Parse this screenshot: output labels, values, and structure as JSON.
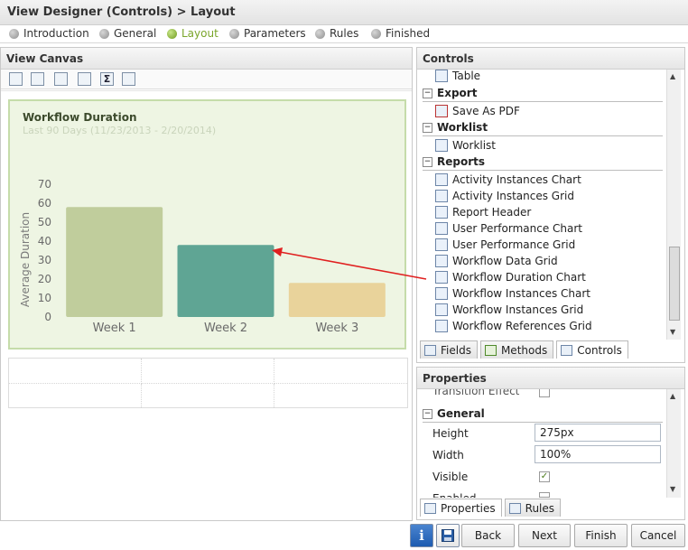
{
  "window": {
    "title": "View Designer (Controls) > Layout"
  },
  "steps": [
    {
      "label": "Introduction",
      "active": false
    },
    {
      "label": "General",
      "active": false
    },
    {
      "label": "Layout",
      "active": true
    },
    {
      "label": "Parameters",
      "active": false
    },
    {
      "label": "Rules",
      "active": false
    },
    {
      "label": "Finished",
      "active": false
    }
  ],
  "canvas": {
    "header": "View Canvas",
    "toolbar": [
      "add-row-icon",
      "edit-layout-icon",
      "insert-table-icon",
      "export-icon",
      "sum-icon",
      "properties-icon"
    ]
  },
  "chart": {
    "title": "Workflow Duration",
    "subtitle": "Last 90 Days (11/23/2013 - 2/20/2014)"
  },
  "chart_data": {
    "type": "bar",
    "title": "Workflow Duration",
    "subtitle": "Last 90 Days (11/23/2013 - 2/20/2014)",
    "xlabel": "",
    "ylabel": "Average Duration",
    "categories": [
      "Week 1",
      "Week 2",
      "Week 3"
    ],
    "values": [
      58,
      38,
      18
    ],
    "colors": [
      "#c0cd9c",
      "#5fa594",
      "#e9d39b"
    ],
    "ylim": [
      0,
      70
    ],
    "yticks": [
      0,
      10,
      20,
      30,
      40,
      50,
      60,
      70
    ],
    "grid": false
  },
  "controls": {
    "header": "Controls",
    "top_item": "Table",
    "groups": [
      {
        "name": "Export",
        "items": [
          "Save As PDF"
        ]
      },
      {
        "name": "Worklist",
        "items": [
          "Worklist"
        ]
      },
      {
        "name": "Reports",
        "items": [
          "Activity Instances Chart",
          "Activity Instances Grid",
          "Report Header",
          "User Performance Chart",
          "User Performance Grid",
          "Workflow Data Grid",
          "Workflow Duration Chart",
          "Workflow Instances Chart",
          "Workflow Instances Grid",
          "Workflow References Grid"
        ]
      }
    ],
    "tabs": [
      "Fields",
      "Methods",
      "Controls"
    ],
    "selected_tab": "Controls"
  },
  "properties": {
    "header": "Properties",
    "partial_top": "Transition Effect",
    "section": "General",
    "rows": [
      {
        "label": "Height",
        "value": "275px"
      },
      {
        "label": "Width",
        "value": "100%"
      },
      {
        "label": "Visible",
        "checked": true
      },
      {
        "label": "Enabled",
        "checked": false
      }
    ],
    "tabs": [
      "Properties",
      "Rules"
    ],
    "selected_tab": "Properties"
  },
  "buttons": {
    "info_icon": "info-icon",
    "save_icon": "save-icon",
    "back": "Back",
    "next": "Next",
    "finish": "Finish",
    "cancel": "Cancel"
  },
  "annotation": {
    "color": "#e02020"
  }
}
